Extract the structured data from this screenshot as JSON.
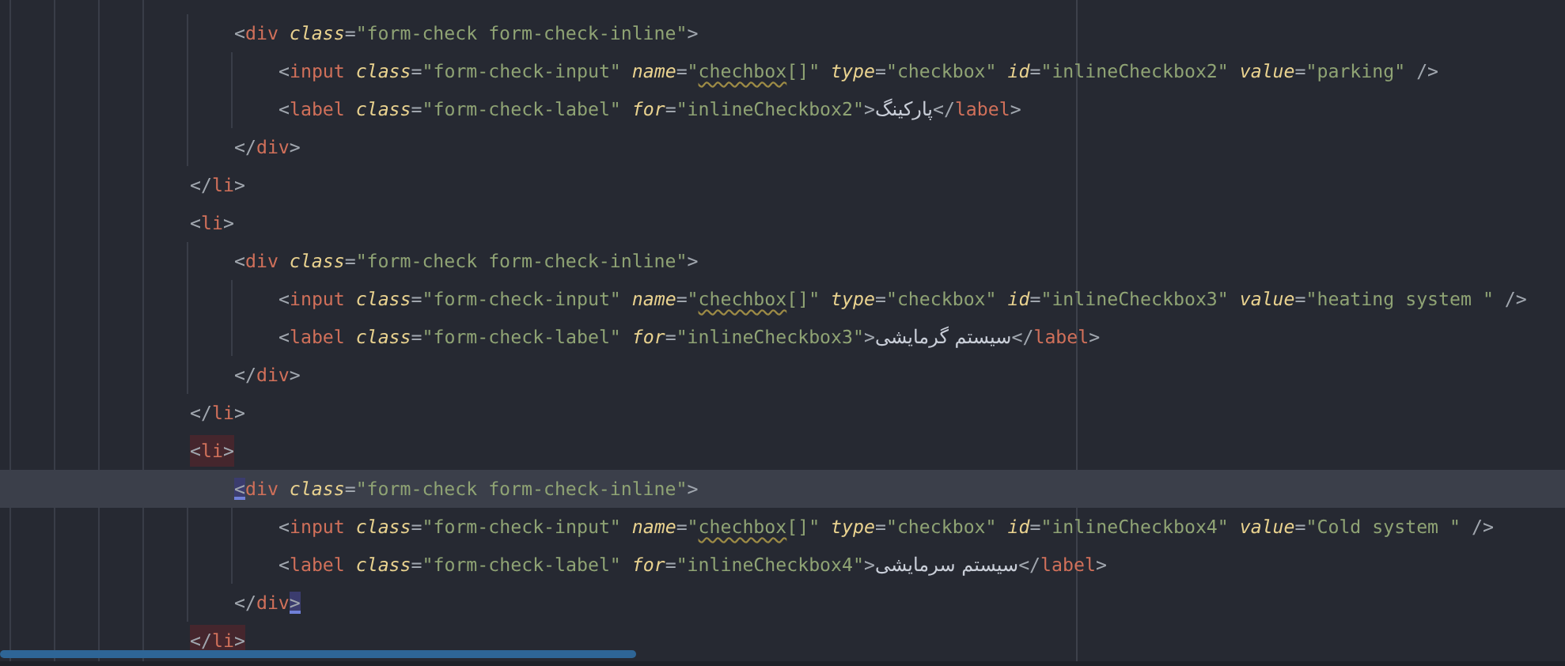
{
  "editor": {
    "lines": [
      {
        "children": [
          {
            "current": false,
            "matched": false,
            "tokens": [
              {
                "kind": "punct",
                "text": "<"
              },
              {
                "kind": "tag",
                "text": "div"
              },
              {
                "kind": "attr",
                "text": " class"
              },
              {
                "kind": "punct",
                "text": "="
              },
              {
                "kind": "string",
                "text": "\"form-check form-check-inline\""
              },
              {
                "kind": "punct",
                "text": ">"
              }
            ],
            "children": [
              {
                "current": false,
                "matched": false,
                "tokens": [
                  {
                    "kind": "punct",
                    "text": "<"
                  },
                  {
                    "kind": "tag",
                    "text": "input"
                  },
                  {
                    "kind": "attr",
                    "text": " class"
                  },
                  {
                    "kind": "punct",
                    "text": "="
                  },
                  {
                    "kind": "string",
                    "text": "\"form-check-input\""
                  },
                  {
                    "kind": "attr",
                    "text": " name"
                  },
                  {
                    "kind": "punct",
                    "text": "="
                  },
                  {
                    "kind": "string",
                    "text": "\""
                  },
                  {
                    "kind": "typo",
                    "text": "chechbox"
                  },
                  {
                    "kind": "string",
                    "text": "[]\""
                  },
                  {
                    "kind": "attr",
                    "text": " type"
                  },
                  {
                    "kind": "punct",
                    "text": "="
                  },
                  {
                    "kind": "string",
                    "text": "\"checkbox\""
                  },
                  {
                    "kind": "attr",
                    "text": " id"
                  },
                  {
                    "kind": "punct",
                    "text": "="
                  },
                  {
                    "kind": "string",
                    "text": "\"inlineCheckbox2\""
                  },
                  {
                    "kind": "attr",
                    "text": " value"
                  },
                  {
                    "kind": "punct",
                    "text": "="
                  },
                  {
                    "kind": "string",
                    "text": "\"parking\""
                  },
                  {
                    "kind": "punct",
                    "text": " />"
                  }
                ]
              },
              {
                "current": false,
                "matched": false,
                "tokens": [
                  {
                    "kind": "punct",
                    "text": "<"
                  },
                  {
                    "kind": "tag",
                    "text": "label"
                  },
                  {
                    "kind": "attr",
                    "text": " class"
                  },
                  {
                    "kind": "punct",
                    "text": "="
                  },
                  {
                    "kind": "string",
                    "text": "\"form-check-label\""
                  },
                  {
                    "kind": "attr",
                    "text": " for"
                  },
                  {
                    "kind": "punct",
                    "text": "="
                  },
                  {
                    "kind": "string",
                    "text": "\"inlineCheckbox2\""
                  },
                  {
                    "kind": "punct",
                    "text": ">"
                  },
                  {
                    "kind": "text",
                    "text": "پارکینگ"
                  },
                  {
                    "kind": "punct",
                    "text": "</"
                  },
                  {
                    "kind": "tag",
                    "text": "label"
                  },
                  {
                    "kind": "punct",
                    "text": ">"
                  }
                ]
              }
            ]
          },
          {
            "current": false,
            "matched": false,
            "tokens": [
              {
                "kind": "punct",
                "text": "</"
              },
              {
                "kind": "tag",
                "text": "div"
              },
              {
                "kind": "punct",
                "text": ">"
              }
            ]
          }
        ]
      },
      {
        "current": false,
        "matched": false,
        "tokens": [
          {
            "kind": "punct",
            "text": "</"
          },
          {
            "kind": "tag",
            "text": "li"
          },
          {
            "kind": "punct",
            "text": ">"
          }
        ]
      },
      {
        "current": false,
        "matched": false,
        "tokens": [
          {
            "kind": "punct",
            "text": "<"
          },
          {
            "kind": "tag",
            "text": "li"
          },
          {
            "kind": "punct",
            "text": ">"
          }
        ],
        "children": [
          {
            "current": false,
            "matched": false,
            "tokens": [
              {
                "kind": "punct",
                "text": "<"
              },
              {
                "kind": "tag",
                "text": "div"
              },
              {
                "kind": "attr",
                "text": " class"
              },
              {
                "kind": "punct",
                "text": "="
              },
              {
                "kind": "string",
                "text": "\"form-check form-check-inline\""
              },
              {
                "kind": "punct",
                "text": ">"
              }
            ],
            "children": [
              {
                "current": false,
                "matched": false,
                "tokens": [
                  {
                    "kind": "punct",
                    "text": "<"
                  },
                  {
                    "kind": "tag",
                    "text": "input"
                  },
                  {
                    "kind": "attr",
                    "text": " class"
                  },
                  {
                    "kind": "punct",
                    "text": "="
                  },
                  {
                    "kind": "string",
                    "text": "\"form-check-input\""
                  },
                  {
                    "kind": "attr",
                    "text": " name"
                  },
                  {
                    "kind": "punct",
                    "text": "="
                  },
                  {
                    "kind": "string",
                    "text": "\""
                  },
                  {
                    "kind": "typo",
                    "text": "chechbox"
                  },
                  {
                    "kind": "string",
                    "text": "[]\""
                  },
                  {
                    "kind": "attr",
                    "text": " type"
                  },
                  {
                    "kind": "punct",
                    "text": "="
                  },
                  {
                    "kind": "string",
                    "text": "\"checkbox\""
                  },
                  {
                    "kind": "attr",
                    "text": " id"
                  },
                  {
                    "kind": "punct",
                    "text": "="
                  },
                  {
                    "kind": "string",
                    "text": "\"inlineCheckbox3\""
                  },
                  {
                    "kind": "attr",
                    "text": " value"
                  },
                  {
                    "kind": "punct",
                    "text": "="
                  },
                  {
                    "kind": "string",
                    "text": "\"heating system \""
                  },
                  {
                    "kind": "punct",
                    "text": " />"
                  }
                ]
              },
              {
                "current": false,
                "matched": false,
                "tokens": [
                  {
                    "kind": "punct",
                    "text": "<"
                  },
                  {
                    "kind": "tag",
                    "text": "label"
                  },
                  {
                    "kind": "attr",
                    "text": " class"
                  },
                  {
                    "kind": "punct",
                    "text": "="
                  },
                  {
                    "kind": "string",
                    "text": "\"form-check-label\""
                  },
                  {
                    "kind": "attr",
                    "text": " for"
                  },
                  {
                    "kind": "punct",
                    "text": "="
                  },
                  {
                    "kind": "string",
                    "text": "\"inlineCheckbox3\""
                  },
                  {
                    "kind": "punct",
                    "text": ">"
                  },
                  {
                    "kind": "text",
                    "text": "سیستم گرمایشی"
                  },
                  {
                    "kind": "punct",
                    "text": "</"
                  },
                  {
                    "kind": "tag",
                    "text": "label"
                  },
                  {
                    "kind": "punct",
                    "text": ">"
                  }
                ]
              }
            ]
          },
          {
            "current": false,
            "matched": false,
            "tokens": [
              {
                "kind": "punct",
                "text": "</"
              },
              {
                "kind": "tag",
                "text": "div"
              },
              {
                "kind": "punct",
                "text": ">"
              }
            ]
          }
        ]
      },
      {
        "current": false,
        "matched": false,
        "tokens": [
          {
            "kind": "punct",
            "text": "</"
          },
          {
            "kind": "tag",
            "text": "li"
          },
          {
            "kind": "punct",
            "text": ">"
          }
        ]
      },
      {
        "current": false,
        "matched": true,
        "tokens": [
          {
            "kind": "punct",
            "text": "<"
          },
          {
            "kind": "tag",
            "text": "li"
          },
          {
            "kind": "punct",
            "text": ">"
          }
        ],
        "children": [
          {
            "current": true,
            "matched": false,
            "tokens": [
              {
                "kind": "brace",
                "text": "<"
              },
              {
                "kind": "tag",
                "text": "div"
              },
              {
                "kind": "attr",
                "text": " class"
              },
              {
                "kind": "punct",
                "text": "="
              },
              {
                "kind": "string",
                "text": "\"form-check form-check-inline\""
              },
              {
                "kind": "punct",
                "text": ">"
              }
            ],
            "children": [
              {
                "current": false,
                "matched": false,
                "tokens": [
                  {
                    "kind": "punct",
                    "text": "<"
                  },
                  {
                    "kind": "tag",
                    "text": "input"
                  },
                  {
                    "kind": "attr",
                    "text": " class"
                  },
                  {
                    "kind": "punct",
                    "text": "="
                  },
                  {
                    "kind": "string",
                    "text": "\"form-check-input\""
                  },
                  {
                    "kind": "attr",
                    "text": " name"
                  },
                  {
                    "kind": "punct",
                    "text": "="
                  },
                  {
                    "kind": "string",
                    "text": "\""
                  },
                  {
                    "kind": "typo",
                    "text": "chechbox"
                  },
                  {
                    "kind": "string",
                    "text": "[]\""
                  },
                  {
                    "kind": "attr",
                    "text": " type"
                  },
                  {
                    "kind": "punct",
                    "text": "="
                  },
                  {
                    "kind": "string",
                    "text": "\"checkbox\""
                  },
                  {
                    "kind": "attr",
                    "text": " id"
                  },
                  {
                    "kind": "punct",
                    "text": "="
                  },
                  {
                    "kind": "string",
                    "text": "\"inlineCheckbox4\""
                  },
                  {
                    "kind": "attr",
                    "text": " value"
                  },
                  {
                    "kind": "punct",
                    "text": "="
                  },
                  {
                    "kind": "string",
                    "text": "\"Cold system \""
                  },
                  {
                    "kind": "punct",
                    "text": " />"
                  }
                ]
              },
              {
                "current": false,
                "matched": false,
                "tokens": [
                  {
                    "kind": "punct",
                    "text": "<"
                  },
                  {
                    "kind": "tag",
                    "text": "label"
                  },
                  {
                    "kind": "attr",
                    "text": " class"
                  },
                  {
                    "kind": "punct",
                    "text": "="
                  },
                  {
                    "kind": "string",
                    "text": "\"form-check-label\""
                  },
                  {
                    "kind": "attr",
                    "text": " for"
                  },
                  {
                    "kind": "punct",
                    "text": "="
                  },
                  {
                    "kind": "string",
                    "text": "\"inlineCheckbox4\""
                  },
                  {
                    "kind": "punct",
                    "text": ">"
                  },
                  {
                    "kind": "text",
                    "text": "سیستم سرمایشی"
                  },
                  {
                    "kind": "punct",
                    "text": "</"
                  },
                  {
                    "kind": "tag",
                    "text": "label"
                  },
                  {
                    "kind": "punct",
                    "text": ">"
                  }
                ]
              }
            ]
          },
          {
            "current": false,
            "matched": false,
            "tokens": [
              {
                "kind": "punct",
                "text": "</"
              },
              {
                "kind": "tag",
                "text": "div"
              },
              {
                "kind": "brace",
                "text": ">"
              }
            ]
          }
        ]
      },
      {
        "current": false,
        "matched": true,
        "tokens": [
          {
            "kind": "punct",
            "text": "</"
          },
          {
            "kind": "tag",
            "text": "li"
          },
          {
            "kind": "punct",
            "text": ">"
          }
        ]
      }
    ]
  }
}
